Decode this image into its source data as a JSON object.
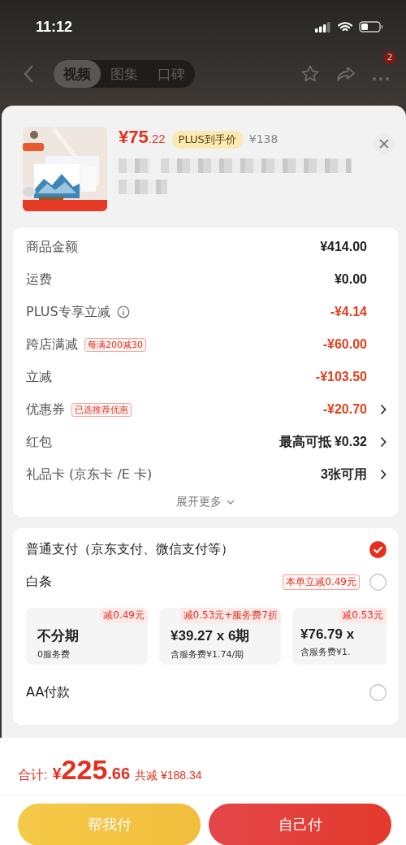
{
  "status_bar": {
    "time": "11:12"
  },
  "nav": {
    "tabs": [
      {
        "label": "视频",
        "selected": true
      },
      {
        "label": "图集",
        "selected": false
      },
      {
        "label": "口碑",
        "selected": false
      }
    ],
    "more_badge": "2"
  },
  "product": {
    "kind": "picture",
    "price_int": "¥75",
    "price_dec": ".22",
    "price_tag": "PLUS到手价",
    "original_price": "¥138"
  },
  "summary": [
    {
      "label": "商品金额",
      "value": "¥414.00",
      "discount": false,
      "arrow": false
    },
    {
      "label": "运费",
      "value": "¥0.00",
      "discount": false,
      "arrow": false
    },
    {
      "label": "PLUS专享立减",
      "info": true,
      "value": "-¥4.14",
      "discount": true,
      "arrow": false
    },
    {
      "label": "跨店满减",
      "tag": "每满200减30",
      "value": "-¥60.00",
      "discount": true,
      "arrow": false
    },
    {
      "label": "立减",
      "value": "-¥103.50",
      "discount": true,
      "arrow": false
    },
    {
      "label": "优惠券",
      "tag": "已选推荐优惠",
      "value": "-¥20.70",
      "discount": true,
      "arrow": true
    },
    {
      "label": "红包",
      "value": "最高可抵 ¥0.32",
      "discount": false,
      "arrow": true
    },
    {
      "label": "礼品卡 (京东卡 /E 卡)",
      "value": "3张可用",
      "discount": false,
      "arrow": true
    }
  ],
  "expand_more": "展开更多",
  "payment_options": [
    {
      "label": "普通支付（京东支付、微信支付等）",
      "selected": true
    },
    {
      "label": "白条",
      "tag": "本单立减0.49元",
      "selected": false,
      "plans": [
        {
          "promo": "减0.49元",
          "title": "不分期",
          "fee": "0服务费"
        },
        {
          "promo": "减0.53元+服务费7折",
          "title": "¥39.27 x 6期",
          "fee": "含服务费¥1.74/期"
        },
        {
          "promo": "减0.53元",
          "title": "¥76.79 x",
          "fee": "含服务费¥1."
        }
      ]
    },
    {
      "label": "AA付款",
      "selected": false
    }
  ],
  "footer": {
    "total_label": "合计:",
    "total_currency": "¥",
    "total_int": "225",
    "total_dec": ".66",
    "saved": "共减 ¥188.34",
    "buttons": [
      {
        "label": "帮我付",
        "kind": "secondary"
      },
      {
        "label": "自己付",
        "kind": "primary"
      }
    ]
  }
}
